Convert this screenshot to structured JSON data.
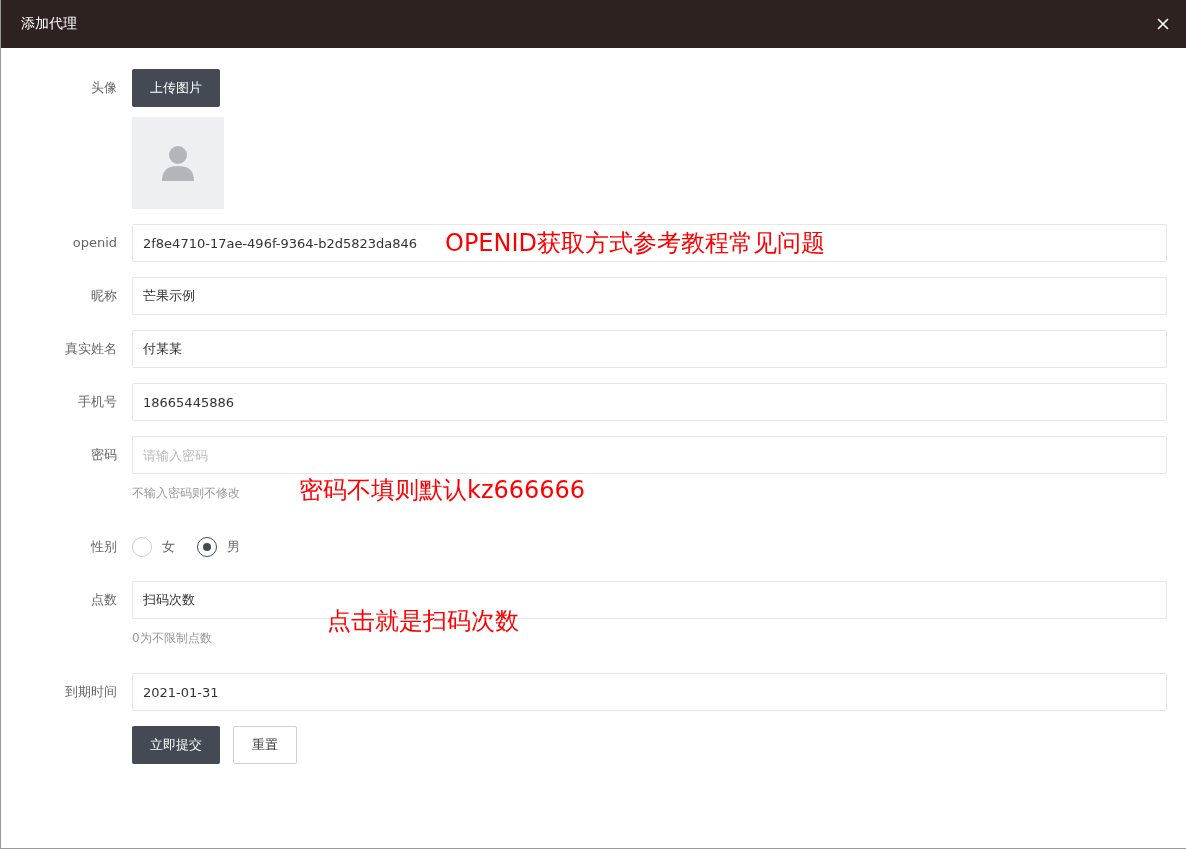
{
  "dialog": {
    "title": "添加代理"
  },
  "fields": [
    {
      "kind": "upload",
      "label": "头像",
      "button": "上传图片"
    },
    {
      "kind": "text",
      "label": "openid",
      "value": "2f8e4710-17ae-496f-9364-b2d5823da846",
      "annotation": "OPENID获取方式参考教程常见问题"
    },
    {
      "kind": "text",
      "label": "昵称",
      "value": "芒果示例"
    },
    {
      "kind": "text",
      "label": "真实姓名",
      "value": "付某某"
    },
    {
      "kind": "text",
      "label": "手机号",
      "value": "18665445886"
    },
    {
      "kind": "text",
      "label": "密码",
      "placeholder": "请输入密码",
      "hint": "不输入密码则不修改",
      "annotation": "密码不填则默认kz666666"
    },
    {
      "kind": "radio",
      "label": "性别",
      "options": [
        {
          "label": "女",
          "selected": false
        },
        {
          "label": "男",
          "selected": true
        }
      ]
    },
    {
      "kind": "text",
      "label": "点数",
      "value": "扫码次数",
      "hint": "0为不限制点数",
      "annotation": "点击就是扫码次数"
    },
    {
      "kind": "text",
      "label": "到期时间",
      "value": "2021-01-31"
    }
  ],
  "buttons": [
    {
      "label": "立即提交",
      "kind": "primary"
    },
    {
      "label": "重置",
      "kind": "plain"
    }
  ]
}
